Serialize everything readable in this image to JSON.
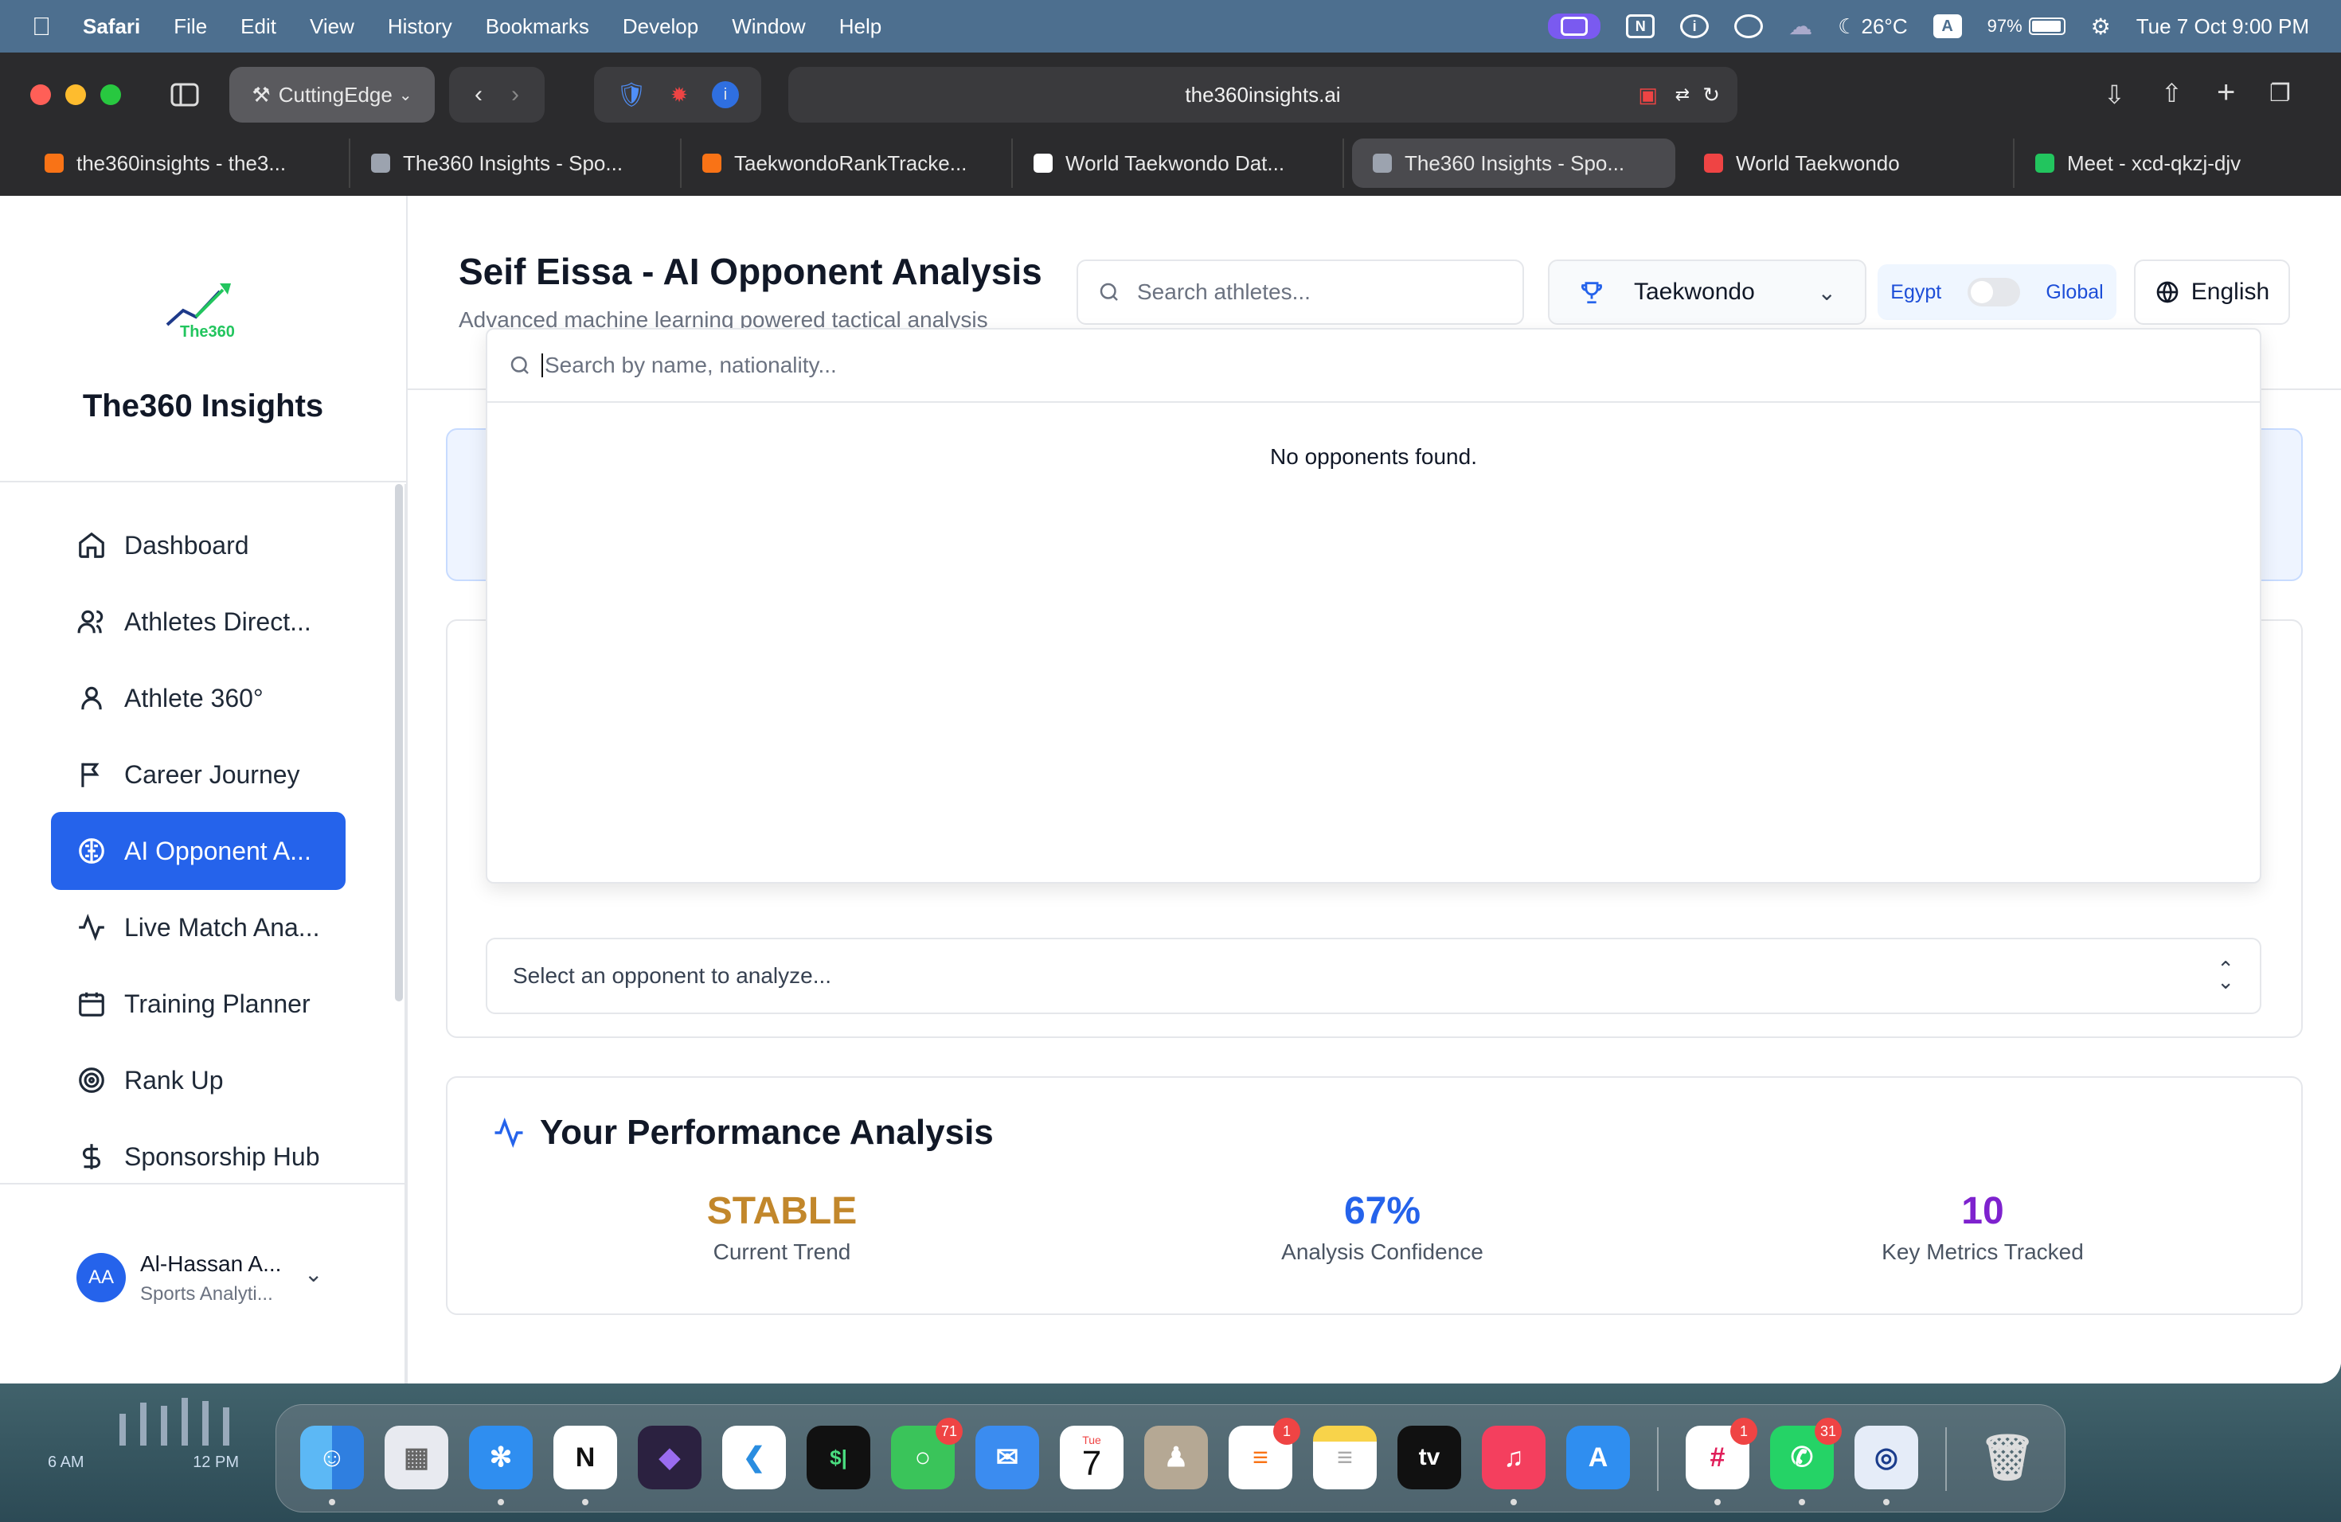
{
  "menubar": {
    "app_name": "Safari",
    "items": [
      "File",
      "Edit",
      "View",
      "History",
      "Bookmarks",
      "Develop",
      "Window",
      "Help"
    ],
    "weather": "26°C",
    "input_source": "A",
    "battery": "97%",
    "datetime": "Tue 7 Oct  9:00 PM"
  },
  "browser": {
    "profile": "CuttingEdge",
    "url": "the360insights.ai",
    "tabs": [
      {
        "label": "the360insights - the3...",
        "color": "#f97316"
      },
      {
        "label": "The360 Insights - Spo...",
        "color": "#9ca3af"
      },
      {
        "label": "TaekwondoRankTracke...",
        "color": "#f97316"
      },
      {
        "label": "World Taekwondo Dat...",
        "color": "#ffffff"
      },
      {
        "label": "The360 Insights - Spo...",
        "color": "#9ca3af"
      },
      {
        "label": "World Taekwondo",
        "color": "#ef4444"
      },
      {
        "label": "Meet - xcd-qkzj-djv",
        "color": "#22c55e"
      }
    ]
  },
  "sidebar": {
    "logo_text": "The360",
    "brand": "The360 Insights",
    "items": [
      {
        "label": "Dashboard",
        "icon": "home-icon"
      },
      {
        "label": "Athletes Direct...",
        "icon": "users-icon"
      },
      {
        "label": "Athlete 360°",
        "icon": "user-icon"
      },
      {
        "label": "Career Journey",
        "icon": "flag-icon"
      },
      {
        "label": "AI Opponent A...",
        "icon": "brain-icon"
      },
      {
        "label": "Live Match Ana...",
        "icon": "activity-icon"
      },
      {
        "label": "Training Planner",
        "icon": "calendar-icon"
      },
      {
        "label": "Rank Up",
        "icon": "target-icon"
      },
      {
        "label": "Sponsorship Hub",
        "icon": "dollar-icon"
      }
    ],
    "user": {
      "initials": "AA",
      "name": "Al-Hassan A...",
      "role": "Sports Analyti..."
    }
  },
  "header": {
    "title": "Seif Eissa - AI Opponent Analysis",
    "subtitle": "Advanced machine learning powered tactical analysis",
    "search_placeholder": "Search athletes...",
    "sport": "Taekwondo",
    "toggle_left": "Egypt",
    "toggle_right": "Global",
    "language": "English"
  },
  "opponent_picker": {
    "search_placeholder": "Search by name, nationality...",
    "empty_text": "No opponents found.",
    "select_placeholder": "Select an opponent to analyze..."
  },
  "performance": {
    "title": "Your Performance Analysis",
    "stats": [
      {
        "value": "STABLE",
        "label": "Current Trend",
        "color": "#c2872b"
      },
      {
        "value": "67%",
        "label": "Analysis Confidence",
        "color": "#2563eb"
      },
      {
        "value": "10",
        "label": "Key Metrics Tracked",
        "color": "#7e22ce"
      }
    ]
  },
  "widget": {
    "left": "6 AM",
    "right": "12 PM"
  },
  "dock": {
    "items": [
      {
        "name": "Finder",
        "badge": ""
      },
      {
        "name": "Launchpad",
        "badge": ""
      },
      {
        "name": "Safari",
        "badge": ""
      },
      {
        "name": "Notion",
        "badge": ""
      },
      {
        "name": "Obsidian",
        "badge": ""
      },
      {
        "name": "VS Code",
        "badge": ""
      },
      {
        "name": "Terminal",
        "badge": ""
      },
      {
        "name": "Messages",
        "badge": "71"
      },
      {
        "name": "Mail",
        "badge": ""
      },
      {
        "name": "Calendar",
        "badge": ""
      },
      {
        "name": "Contacts",
        "badge": ""
      },
      {
        "name": "Reminders",
        "badge": "1"
      },
      {
        "name": "Notes",
        "badge": ""
      },
      {
        "name": "TV",
        "badge": ""
      },
      {
        "name": "Music",
        "badge": ""
      },
      {
        "name": "App Store",
        "badge": ""
      },
      {
        "name": "Slack",
        "badge": "1"
      },
      {
        "name": "WhatsApp",
        "badge": "31"
      },
      {
        "name": "1Password",
        "badge": ""
      },
      {
        "name": "Trash",
        "badge": ""
      }
    ],
    "calendar_month": "Tue",
    "calendar_day": "7",
    "tv_label": "tv",
    "terminal_label": "$|"
  }
}
